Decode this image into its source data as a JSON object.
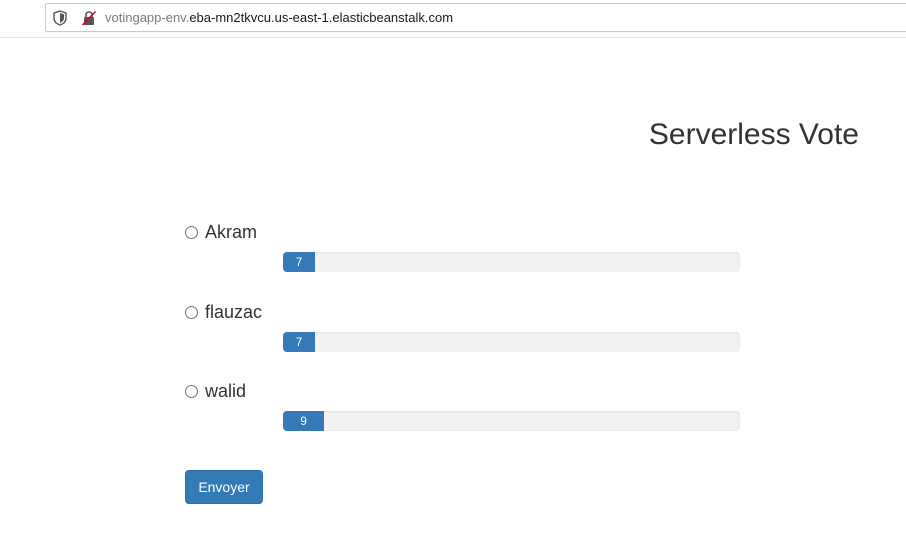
{
  "browser": {
    "url_dim": "votingapp-env.",
    "url_main": "eba-mn2tkvcu.us-east-1.elasticbeanstalk.com"
  },
  "page": {
    "title": "Serverless Vote",
    "submit_label": "Envoyer"
  },
  "colors": {
    "accent": "#337ab7",
    "track": "#f2f2f2"
  },
  "options": [
    {
      "name": "Akram",
      "votes": "7",
      "fill_percent": 7
    },
    {
      "name": "flauzac",
      "votes": "7",
      "fill_percent": 7
    },
    {
      "name": "walid",
      "votes": "9",
      "fill_percent": 9
    }
  ]
}
